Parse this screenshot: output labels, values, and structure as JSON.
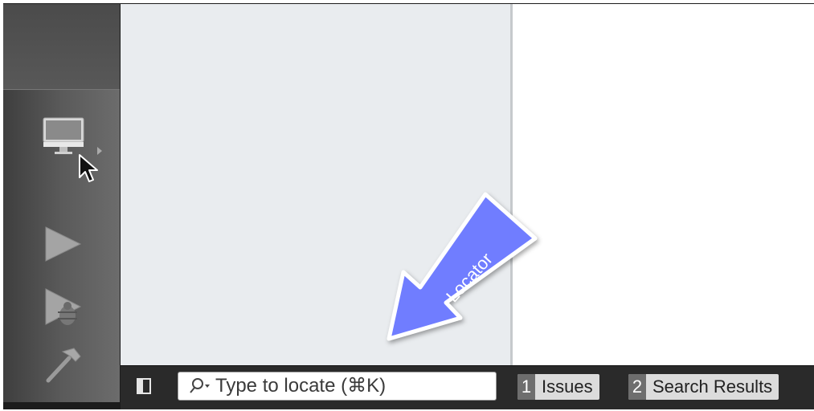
{
  "sidebar": {
    "icons": [
      "computer-icon",
      "play-icon",
      "debug-icon",
      "hammer-icon"
    ],
    "computer_menu_indicator": "chevron-right-icon"
  },
  "bottom_bar": {
    "locator_placeholder": "Type to locate (⌘K)",
    "tabs": [
      {
        "number": "1",
        "label": "Issues"
      },
      {
        "number": "2",
        "label": "Search Results"
      }
    ]
  },
  "callout": {
    "label": "Locator",
    "color": "#6f7dff"
  },
  "colors": {
    "navigator_bg": "#e9ecef",
    "sidebar_bg": "#5a5a5a",
    "bottom_bar_bg": "#2a2a2a"
  }
}
